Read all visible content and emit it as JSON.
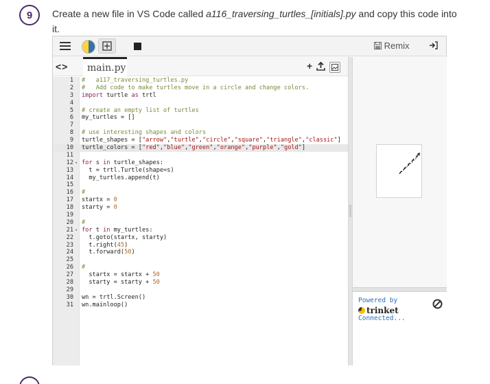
{
  "step": {
    "number": "9",
    "text_before": "Create a new file in VS Code called ",
    "filename": "a116_traversing_turtles_[initials].py",
    "text_after": " and copy this code into it."
  },
  "trinket": {
    "remix_label": "Remix",
    "file_tab": "main.py",
    "powered_by": "Powered by",
    "brand_name": "trinket",
    "status": "Connected..."
  },
  "code_lines": [
    "#   a117_traversing_turtles.py",
    "#   Add code to make turtles move in a circle and change colors.",
    "import turtle as trtl",
    "",
    "# create an empty list of turtles",
    "my_turtles = []",
    "",
    "# use interesting shapes and colors",
    "turtle_shapes = [\"arrow\",\"turtle\",\"circle\",\"square\",\"triangle\",\"classic\"]",
    "turtle_colors = [\"red\",\"blue\",\"green\",\"orange\",\"purple\",\"gold\"]",
    "",
    "for s in turtle_shapes:",
    "  t = trtl.Turtle(shape=s)",
    "  my_turtles.append(t)",
    "",
    "#",
    "startx = 0",
    "starty = 0",
    "",
    "#",
    "for t in my_turtles:",
    "  t.goto(startx, starty)",
    "  t.right(45)",
    "  t.forward(50)",
    "",
    "#",
    "  startx = startx + 50",
    "  starty = starty + 50",
    "",
    "wn = trtl.Screen()",
    "wn.mainloop()"
  ],
  "active_line": 10,
  "fold_lines": [
    12,
    21
  ],
  "colors": {
    "accent": "#4a2a6a",
    "link": "#2a6ebb",
    "comment": "#7a8a3a",
    "keyword": "#8b2252",
    "string": "#a31515",
    "number": "#b5651d"
  },
  "icons": [
    "menu-icon",
    "python-icon",
    "drawing-icon",
    "stop-icon",
    "remix-icon",
    "login-icon",
    "nav-arrows-icon",
    "add-file-icon",
    "upload-icon",
    "image-icon",
    "cancel-icon",
    "trinket-logo-icon"
  ]
}
